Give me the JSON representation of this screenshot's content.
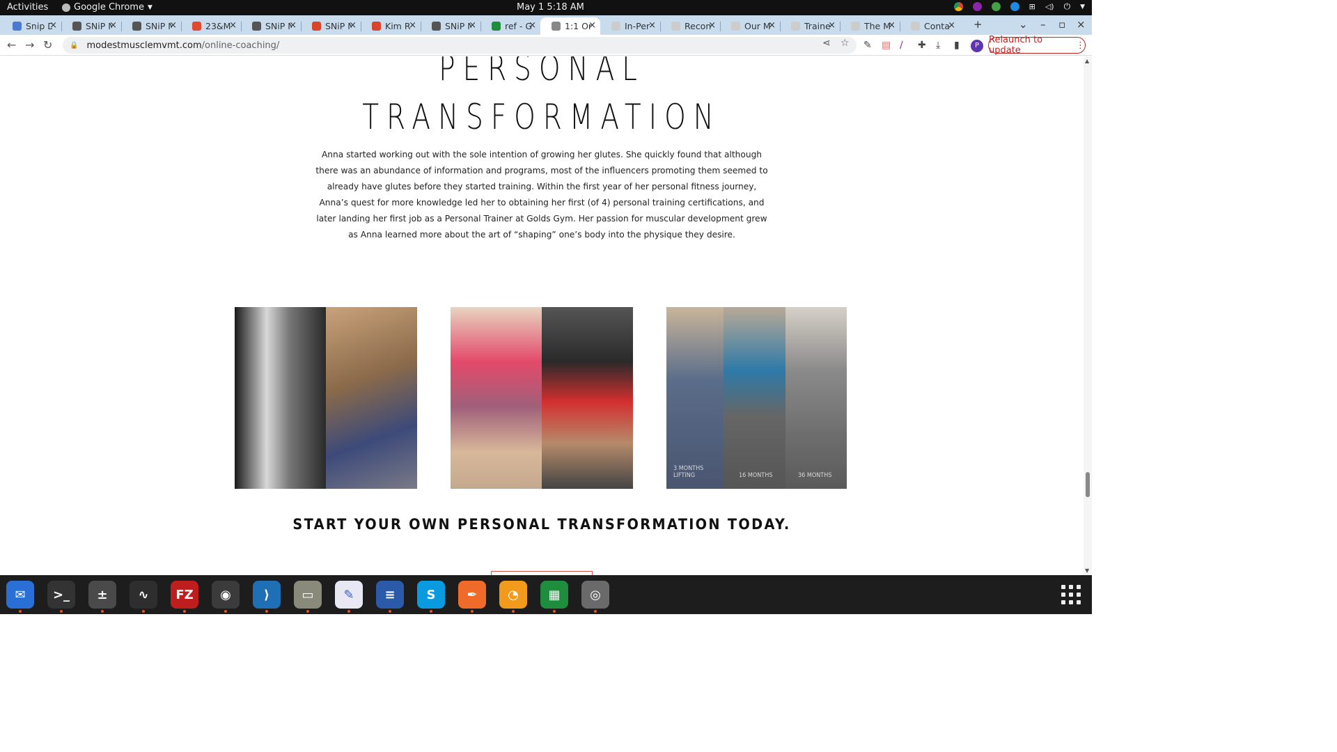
{
  "system": {
    "activities": "Activities",
    "app_name": "Google Chrome",
    "clock": "May 1   5:18 AM"
  },
  "browser": {
    "tabs": [
      {
        "title": "Snip D",
        "color": "#4a7bd0"
      },
      {
        "title": "SNiP N",
        "color": "#555555"
      },
      {
        "title": "SNiP N",
        "color": "#555555"
      },
      {
        "title": "23&M",
        "color": "#e2492f"
      },
      {
        "title": "SNiP N",
        "color": "#555555"
      },
      {
        "title": "SNiP N",
        "color": "#d9452b"
      },
      {
        "title": "Kim R",
        "color": "#d9452b"
      },
      {
        "title": "SNiP N",
        "color": "#555555"
      },
      {
        "title": "ref - G",
        "color": "#1e8e3e"
      },
      {
        "title": "1:1 Or",
        "color": "#888888"
      },
      {
        "title": "In-Per",
        "color": "#cccccc"
      },
      {
        "title": "Recon",
        "color": "#cccccc"
      },
      {
        "title": "Our M",
        "color": "#cccccc"
      },
      {
        "title": "Traine",
        "color": "#cccccc"
      },
      {
        "title": "The M",
        "color": "#cccccc"
      },
      {
        "title": "Conta",
        "color": "#cccccc"
      }
    ],
    "active_tab_index": 9,
    "url_host": "modestmusclemvmt.com",
    "url_path": "/online-coaching/",
    "relaunch_label": "Relaunch to update",
    "profile_initial": "P"
  },
  "page": {
    "heading_line1": "PERSONAL",
    "heading_line2": "TRANSFORMATION",
    "story": "Anna started working out with the sole intention of growing her glutes. She quickly found that although there was an abundance of information and programs, most of the influencers promoting them seemed to already have glutes before they started training. Within the first year of her personal fitness journey, Anna’s quest for more knowledge led her to obtaining her first (of 4) personal training certifications, and later landing her first job as a Personal Trainer at Golds Gym. Her passion for muscular development grew as Anna learned more about the art of “shaping” one’s body into the physique they desire.",
    "photo_captions": [
      "3 MONTHS LIFTING",
      "16 MONTHS",
      "36 MONTHS"
    ],
    "cta_heading": "START YOUR OWN PERSONAL TRANSFORMATION TODAY."
  },
  "dock": [
    {
      "name": "thunderbird",
      "color": "#2a6fd6",
      "glyph": "✉"
    },
    {
      "name": "terminal",
      "color": "#333333",
      "glyph": ">_"
    },
    {
      "name": "calculator",
      "color": "#4a4a4a",
      "glyph": "±"
    },
    {
      "name": "system-monitor",
      "color": "#2e2e2e",
      "glyph": "∿"
    },
    {
      "name": "filezilla",
      "color": "#bf1e1e",
      "glyph": "FZ"
    },
    {
      "name": "chrome",
      "color": "#3b3b3b",
      "glyph": "◉"
    },
    {
      "name": "vscode",
      "color": "#1f6fb5",
      "glyph": "⟩"
    },
    {
      "name": "files",
      "color": "#8a8a7a",
      "glyph": "▭"
    },
    {
      "name": "text-editor",
      "color": "#e8e8f4",
      "glyph": "✎"
    },
    {
      "name": "writer",
      "color": "#2a5aa8",
      "glyph": "≡"
    },
    {
      "name": "skype",
      "color": "#0a9ae0",
      "glyph": "S"
    },
    {
      "name": "inkscape",
      "color": "#f06a2a",
      "glyph": "✒"
    },
    {
      "name": "blender",
      "color": "#f29a1c",
      "glyph": "◔"
    },
    {
      "name": "calc",
      "color": "#1e8e3e",
      "glyph": "▦"
    },
    {
      "name": "disks",
      "color": "#6a6a6a",
      "glyph": "◎"
    }
  ]
}
